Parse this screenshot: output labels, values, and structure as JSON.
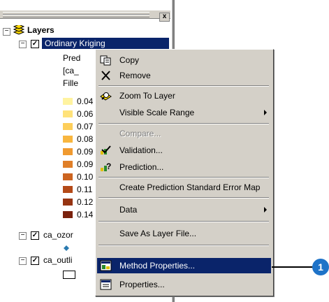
{
  "toc": {
    "close_glyph": "x",
    "root_label": "Layers",
    "layer_kriging": "Ordinary Kriging",
    "sub_items": [
      "Pred",
      "[ca_",
      "Fille"
    ],
    "legend": [
      {
        "label": "0.04",
        "color": "#fff3a0"
      },
      {
        "label": "0.06",
        "color": "#ffe27a"
      },
      {
        "label": "0.07",
        "color": "#fdce5a"
      },
      {
        "label": "0.08",
        "color": "#f8b63f"
      },
      {
        "label": "0.09",
        "color": "#f09a30"
      },
      {
        "label": "0.09",
        "color": "#e07f28"
      },
      {
        "label": "0.10",
        "color": "#cc6420"
      },
      {
        "label": "0.11",
        "color": "#b44a18"
      },
      {
        "label": "0.12",
        "color": "#963412"
      },
      {
        "label": "0.14",
        "color": "#7a220e"
      }
    ],
    "layer_ozone": "ca_ozor",
    "layer_outline": "ca_outli"
  },
  "menu": {
    "copy": "Copy",
    "remove": "Remove",
    "zoom_to_layer": "Zoom To Layer",
    "visible_scale_range": "Visible Scale Range",
    "compare": "Compare...",
    "validation": "Validation...",
    "prediction": "Prediction...",
    "create_pse_map": "Create Prediction Standard Error Map",
    "data": "Data",
    "save_as_layer_file": "Save As Layer File...",
    "method_properties": "Method Properties...",
    "properties": "Properties..."
  },
  "callout": {
    "number": "1",
    "color": "#1e73c8"
  }
}
